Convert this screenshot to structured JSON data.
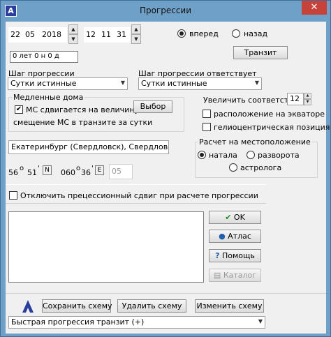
{
  "window": {
    "title": "Прогрессии",
    "close_glyph": "✕",
    "app_icon_glyph": "A"
  },
  "date": {
    "day": "22",
    "month": "05",
    "year": "2018"
  },
  "time": {
    "hour": "12",
    "minute": "11",
    "second": "31"
  },
  "direction": {
    "forward": "вперед",
    "backward": "назад",
    "selected": "forward"
  },
  "age_display": "0 лет 0 н 0 д",
  "transit_button": "Транзит",
  "step": {
    "label": "Шаг прогрессии",
    "value": "Сутки истинные",
    "corresponds_label": "Шаг прогрессии  ответствует",
    "corresponds_value": "Сутки истинные"
  },
  "slow_houses": {
    "legend": "Медленные дома",
    "mc_shift_label": "МС сдвигается на величину :",
    "mc_shift_checked": true,
    "select_button": "Выбор",
    "mc_offset_text": "смещение МС в транзите за сутки"
  },
  "increase": {
    "label": "Увеличить соответствие",
    "value": "12"
  },
  "options": {
    "equator": "расположение на экваторе",
    "heliocentric": "гелиоцентрическая позиция"
  },
  "location": {
    "place": "Екатеринбург (Свердловск), Свердловская с",
    "lat_deg": "56",
    "lat_min": "51",
    "lat_dir": "N",
    "lon_deg": "060",
    "lon_min": "36",
    "lon_dir": "E",
    "tz": "05"
  },
  "calc": {
    "legend": "Расчет на местоположение",
    "natal": "натала",
    "reversal": "разворота",
    "astrologer": "астролога",
    "selected": "natal"
  },
  "precession": {
    "label": "Отключить прецессионный сдвиг при расчете прогрессии",
    "checked": false
  },
  "side_buttons": {
    "ok": "OK",
    "atlas": "Атлас",
    "help": "Помощь",
    "catalog": "Каталог"
  },
  "scheme": {
    "save": "Сохранить схему",
    "delete": "Удалить схему",
    "change": "Изменить схему",
    "selected": "Быстрая прогрессия транзит (+)"
  }
}
